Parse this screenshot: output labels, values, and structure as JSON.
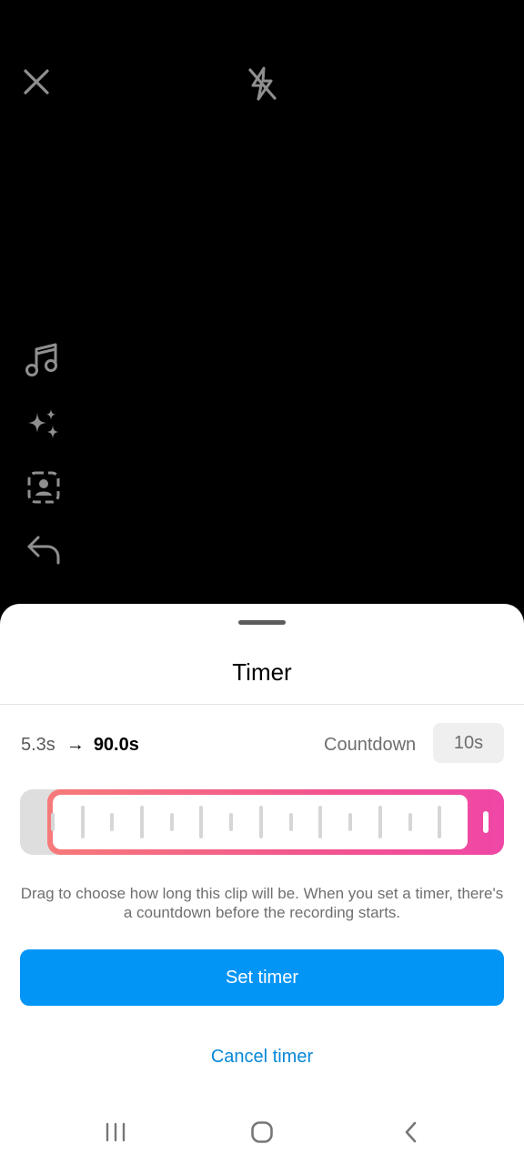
{
  "camera": {
    "icons": [
      "close-icon",
      "flash-off-icon",
      "music-icon",
      "effects-sparkle-icon",
      "portrait-mode-icon",
      "undo-icon"
    ]
  },
  "timer_sheet": {
    "title": "Timer",
    "range_start": "5.3s",
    "range_end": "90.0s",
    "countdown_label": "Countdown",
    "countdown_value": "10s",
    "description": "Drag to choose how long this clip will be. When you set a timer, there's a countdown before the recording starts.",
    "set_timer_label": "Set timer",
    "cancel_timer_label": "Cancel timer",
    "colors": {
      "primary": "#0395f6",
      "link": "#0787d8",
      "slider_gradient_start": "#f77a7a",
      "slider_gradient_end": "#ef47a6"
    }
  },
  "navbar": {
    "icons": [
      "recent-apps-icon",
      "home-icon",
      "back-icon"
    ]
  }
}
